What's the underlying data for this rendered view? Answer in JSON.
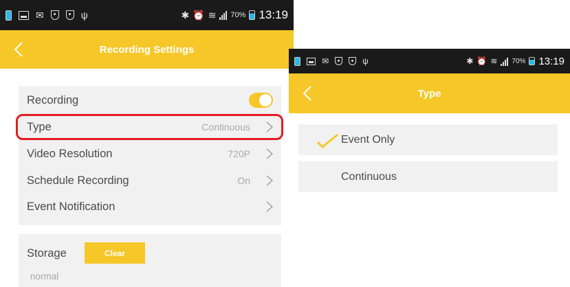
{
  "status_bar": {
    "battery_percent": "70%",
    "time": "13:19",
    "icons_left": [
      "battery-charging-icon",
      "image-icon",
      "chat-icon",
      "shield-icon",
      "shield-icon",
      "usb-icon"
    ],
    "icons_right": [
      "bluetooth-icon",
      "alarm-icon",
      "wifi-icon",
      "signal-icon",
      "battery-icon"
    ]
  },
  "recording_settings": {
    "title": "Recording Settings",
    "rows": [
      {
        "label": "Recording",
        "value": "",
        "toggle_on": true
      },
      {
        "label": "Type",
        "value": "Continuous"
      },
      {
        "label": "Video Resolution",
        "value": "720P"
      },
      {
        "label": "Schedule Recording",
        "value": "On"
      },
      {
        "label": "Event Notification",
        "value": ""
      }
    ],
    "storage": {
      "label": "Storage",
      "clear_label": "Clear",
      "status": "normal"
    }
  },
  "type_screen": {
    "title": "Type",
    "options": [
      {
        "label": "Event Only",
        "selected": true
      },
      {
        "label": "Continuous",
        "selected": false
      }
    ]
  },
  "colors": {
    "accent": "#f6c728",
    "highlight": "#e31b23",
    "card_bg": "#f1f1f1",
    "status_bar": "#1a1a1a"
  }
}
